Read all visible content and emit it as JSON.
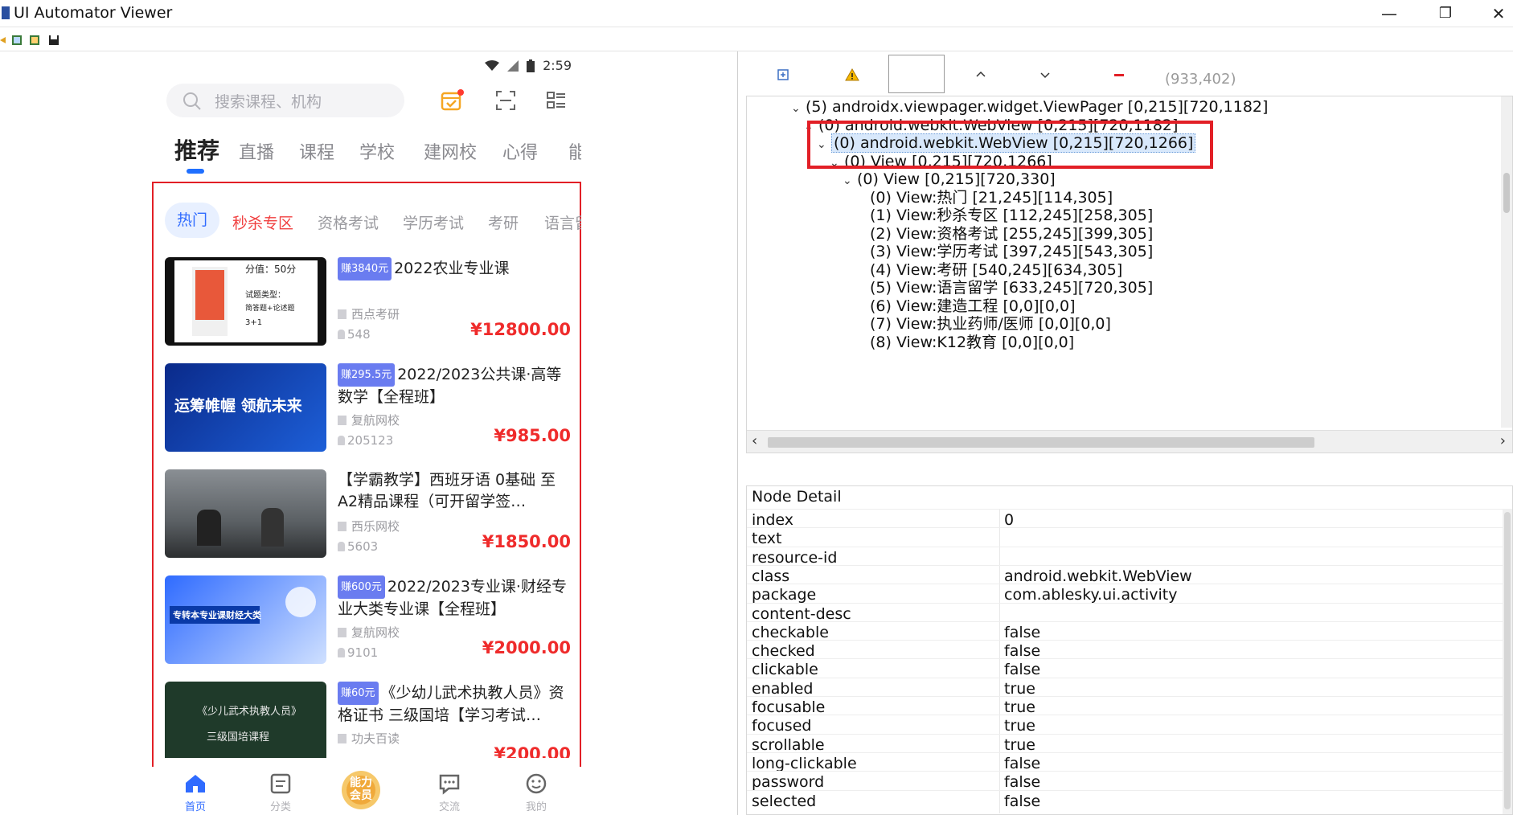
{
  "window": {
    "title": "UI Automator Viewer",
    "minimize": "—",
    "restore": "❐",
    "close": "✕"
  },
  "device": {
    "status": {
      "time": "2:59"
    },
    "search": {
      "placeholder": "搜索课程、机构"
    },
    "main_tabs": [
      {
        "label": "推荐",
        "active": true
      },
      {
        "label": "直播"
      },
      {
        "label": "课程"
      },
      {
        "label": "学校"
      },
      {
        "label": "建网校"
      },
      {
        "label": "心得"
      },
      {
        "label": "能"
      }
    ],
    "sub_tabs": [
      {
        "label": "热门"
      },
      {
        "label": "秒杀专区"
      },
      {
        "label": "资格考试"
      },
      {
        "label": "学历考试"
      },
      {
        "label": "考研"
      },
      {
        "label": "语言留"
      }
    ],
    "courses": [
      {
        "badge": "赚3840元",
        "title": "2022农业专业课",
        "school": "西点考研",
        "count": "548",
        "price": "¥12800.00",
        "thumb_lines": [
          "分值：50分",
          "试题类型：",
          "简答题+论述题",
          "3+1"
        ]
      },
      {
        "badge": "赚295.5元",
        "title": "2022/2023公共课·高等数学【全程班】",
        "school": "复航网校",
        "count": "205123",
        "price": "¥985.00",
        "thumb_lines": [
          "运筹帷幄 领航未来"
        ]
      },
      {
        "badge": "",
        "title": "【学霸教学】西班牙语 0基础 至 A2精品课程（可开留学签…",
        "school": "西乐网校",
        "count": "5603",
        "price": "¥1850.00",
        "thumb_lines": []
      },
      {
        "badge": "赚600元",
        "title": "2022/2023专业课·财经专业大类专业课【全程班】",
        "school": "复航网校",
        "count": "9101",
        "price": "¥2000.00",
        "thumb_lines": [
          "专转本专业课财经大类"
        ]
      },
      {
        "badge": "赚60元",
        "title": "《少幼儿武术执教人员》资格证书 三级国培【学习考试…",
        "school": "功夫百读",
        "count": "",
        "price": "¥200.00",
        "thumb_lines": [
          "《少儿武术执教人员》",
          "三级国培课程"
        ]
      }
    ],
    "bottom_nav": [
      {
        "label": "首页",
        "icon": "home-icon"
      },
      {
        "label": "分类",
        "icon": "category-icon"
      },
      {
        "label": "能力会员",
        "icon": "vip-badge-icon"
      },
      {
        "label": "交流",
        "icon": "chat-icon"
      },
      {
        "label": "我的",
        "icon": "smile-icon"
      }
    ]
  },
  "inspector": {
    "coords": "(933,402)",
    "tree": [
      {
        "indent": 0,
        "label": "(5) androidx.viewpager.widget.ViewPager [0,215][720,1182]",
        "toggle": "v"
      },
      {
        "indent": 1,
        "label": "(0) android.webkit.WebView [0,215][720,1182]",
        "toggle": "v"
      },
      {
        "indent": 2,
        "label": "(0) android.webkit.WebView [0,215][720,1266]",
        "toggle": "v",
        "selected": true
      },
      {
        "indent": 3,
        "label": "(0) View [0,215][720,1266]",
        "toggle": "v"
      },
      {
        "indent": 4,
        "label": "(0) View [0,215][720,330]",
        "toggle": "v"
      },
      {
        "indent": 5,
        "label": "(0) View:热门 [21,245][114,305]",
        "toggle": ""
      },
      {
        "indent": 5,
        "label": "(1) View:秒杀专区 [112,245][258,305]",
        "toggle": ""
      },
      {
        "indent": 5,
        "label": "(2) View:资格考试 [255,245][399,305]",
        "toggle": ""
      },
      {
        "indent": 5,
        "label": "(3) View:学历考试 [397,245][543,305]",
        "toggle": ""
      },
      {
        "indent": 5,
        "label": "(4) View:考研 [540,245][634,305]",
        "toggle": ""
      },
      {
        "indent": 5,
        "label": "(5) View:语言留学 [633,245][720,305]",
        "toggle": ""
      },
      {
        "indent": 5,
        "label": "(6) View:建造工程 [0,0][0,0]",
        "toggle": ""
      },
      {
        "indent": 5,
        "label": "(7) View:执业药师/医师 [0,0][0,0]",
        "toggle": ""
      },
      {
        "indent": 5,
        "label": "(8) View:K12教育 [0,0][0,0]",
        "toggle": ""
      }
    ],
    "detail": {
      "title": "Node Detail",
      "rows": [
        {
          "key": "index",
          "value": "0"
        },
        {
          "key": "text",
          "value": ""
        },
        {
          "key": "resource-id",
          "value": ""
        },
        {
          "key": "class",
          "value": "android.webkit.WebView"
        },
        {
          "key": "package",
          "value": "com.ablesky.ui.activity"
        },
        {
          "key": "content-desc",
          "value": ""
        },
        {
          "key": "checkable",
          "value": "false"
        },
        {
          "key": "checked",
          "value": "false"
        },
        {
          "key": "clickable",
          "value": "false"
        },
        {
          "key": "enabled",
          "value": "true"
        },
        {
          "key": "focusable",
          "value": "true"
        },
        {
          "key": "focused",
          "value": "true"
        },
        {
          "key": "scrollable",
          "value": "true"
        },
        {
          "key": "long-clickable",
          "value": "false"
        },
        {
          "key": "password",
          "value": "false"
        },
        {
          "key": "selected",
          "value": "false"
        }
      ]
    }
  }
}
